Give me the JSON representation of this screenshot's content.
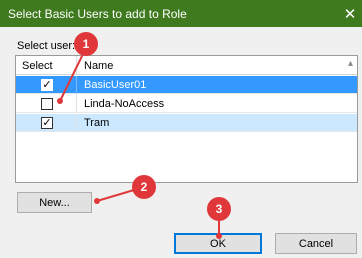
{
  "window": {
    "title": "Select Basic Users to add to Role",
    "close_glyph": "✕"
  },
  "select_user_label": "Select user:",
  "grid": {
    "columns": [
      "Select",
      "Name"
    ],
    "sort_glyph": "▴",
    "rows": [
      {
        "checked": true,
        "name": "BasicUser01",
        "state": "selected"
      },
      {
        "checked": false,
        "name": "Linda-NoAccess",
        "state": "normal"
      },
      {
        "checked": true,
        "name": "Tram",
        "state": "highlighted"
      }
    ]
  },
  "buttons": {
    "new_label": "New...",
    "ok_label": "OK",
    "cancel_label": "Cancel"
  },
  "callouts": [
    "1",
    "2",
    "3"
  ],
  "colors": {
    "titlebar": "#3f7a1f",
    "selection": "#3399ff",
    "highlight": "#cce8ff",
    "callout": "#e0383a",
    "ok_border": "#0078d7"
  },
  "icons": {
    "check": "check-icon",
    "close": "close-icon",
    "sort": "sort-up-icon"
  }
}
